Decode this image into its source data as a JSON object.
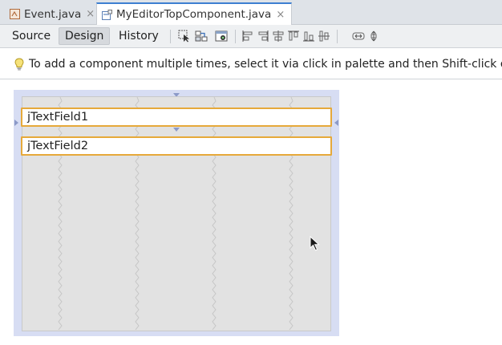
{
  "tabs": [
    {
      "label": "Event.java",
      "close": "×",
      "active": false
    },
    {
      "label": "MyEditorTopComponent.java",
      "close": "×",
      "active": true
    }
  ],
  "toolbar": {
    "views": [
      "Source",
      "Design",
      "History"
    ],
    "selected_view": "Design",
    "icons": [
      "selection-mode-icon",
      "connection-mode-icon",
      "preview-design-icon",
      "align-left-icon",
      "align-right-icon",
      "center-horizontally-icon",
      "align-top-icon",
      "align-bottom-icon",
      "center-vertically-icon",
      "change-horizontal-resizability-icon",
      "change-vertical-resizability-icon"
    ]
  },
  "hint": {
    "text": "To add a component multiple times, select it via click in palette and then Shift-click on design"
  },
  "form": {
    "fields": [
      "jTextField1",
      "jTextField2"
    ]
  },
  "colors": {
    "active_tab_accent": "#3d7fd1",
    "selection_border": "#e6a93a",
    "form_margin": "#d7ddf3",
    "form_background": "#e2e2e2"
  }
}
